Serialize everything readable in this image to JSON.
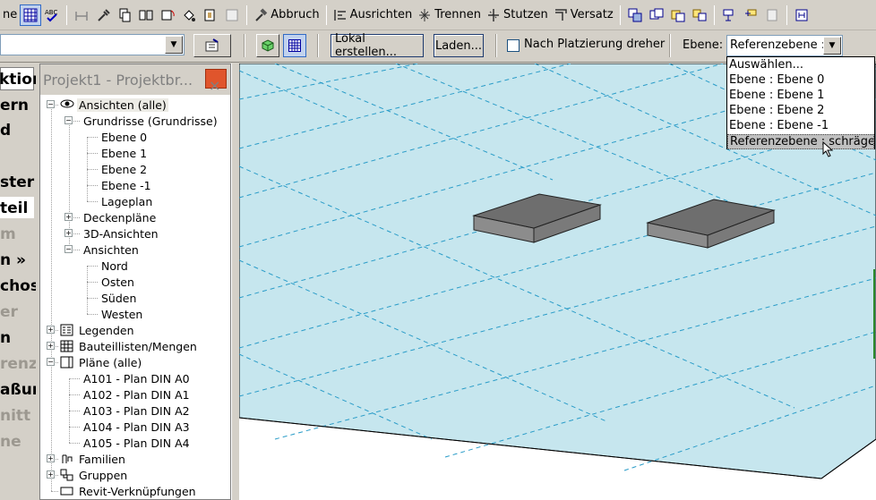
{
  "toolbar1": {
    "left_label": "ne",
    "abbruch": "Abbruch",
    "ausrichten": "Ausrichten",
    "trennen": "Trennen",
    "stutzen": "Stutzen",
    "versatz": "Versatz"
  },
  "toolbar2": {
    "lokal_label": "Lokal erstellen...",
    "laden_label": "Laden...",
    "checkbox_label": "Nach Platzierung dreher",
    "ebene_label": "Ebene:",
    "ebene_value": "Referenzebene :"
  },
  "dropdown": {
    "options": [
      "Auswählen...",
      "Ebene : Ebene 0",
      "Ebene : Ebene 1",
      "Ebene : Ebene 2",
      "Ebene : Ebene -1",
      "Referenzebene : schräge"
    ],
    "selected_index": 5
  },
  "left_panel": {
    "items": [
      "ktion",
      "ern",
      "d",
      "ster",
      "teil",
      "m",
      "n »",
      "chos",
      "er",
      "n",
      "renz",
      "aßur",
      "nitt",
      "ne"
    ]
  },
  "browser": {
    "title": "Projekt1 - Projektbr...",
    "close": "×",
    "tree": [
      {
        "label": "Ansichten (alle)",
        "level": 0,
        "expander": "-",
        "icon": "eye-icon",
        "selected": true
      },
      {
        "label": "Grundrisse (Grundrisse)",
        "level": 1,
        "expander": "-"
      },
      {
        "label": "Ebene 0",
        "level": 2
      },
      {
        "label": "Ebene 1",
        "level": 2
      },
      {
        "label": "Ebene 2",
        "level": 2
      },
      {
        "label": "Ebene -1",
        "level": 2
      },
      {
        "label": "Lageplan",
        "level": 2
      },
      {
        "label": "Deckenpläne",
        "level": 1,
        "expander": "+"
      },
      {
        "label": "3D-Ansichten",
        "level": 1,
        "expander": "+"
      },
      {
        "label": "Ansichten",
        "level": 1,
        "expander": "-"
      },
      {
        "label": "Nord",
        "level": 2
      },
      {
        "label": "Osten",
        "level": 2
      },
      {
        "label": "Süden",
        "level": 2
      },
      {
        "label": "Westen",
        "level": 2
      },
      {
        "label": "Legenden",
        "level": 0,
        "expander": "+",
        "icon": "legend-icon"
      },
      {
        "label": "Bauteillisten/Mengen",
        "level": 0,
        "expander": "+",
        "icon": "schedule-icon"
      },
      {
        "label": "Pläne (alle)",
        "level": 0,
        "expander": "-",
        "icon": "sheet-icon"
      },
      {
        "label": "A101 - Plan DIN A0",
        "level": 1
      },
      {
        "label": "A102 - Plan DIN A1",
        "level": 1
      },
      {
        "label": "A103 - Plan DIN A2",
        "level": 1
      },
      {
        "label": "A104 - Plan DIN A3",
        "level": 1
      },
      {
        "label": "A105 - Plan DIN A4",
        "level": 1
      },
      {
        "label": "Familien",
        "level": 0,
        "expander": "+",
        "icon": "family-icon"
      },
      {
        "label": "Gruppen",
        "level": 0,
        "expander": "+",
        "icon": "group-icon"
      },
      {
        "label": "Revit-Verknüpfungen",
        "level": 0,
        "icon": "link-icon"
      }
    ]
  },
  "colors": {
    "plane_fill": "#c6e6ee",
    "grid_line": "#2a9cc8",
    "box_top": "#6e6e6e",
    "box_side": "#8c8c8c"
  }
}
